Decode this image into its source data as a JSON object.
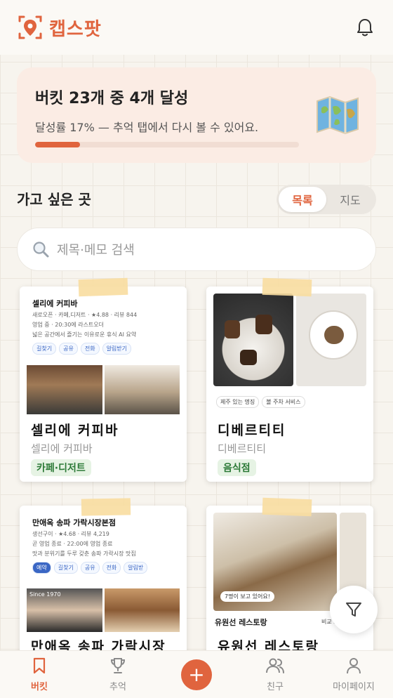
{
  "header": {
    "logo_text": "캡스팟",
    "logo_icon": "map-pin-icon",
    "bell_icon": "bell-icon"
  },
  "progress": {
    "title": "버킷 23개 중 4개 달성",
    "subtitle": "달성률 17% — 추억 탭에서 다시 볼 수 있어요.",
    "fraction": 0.17,
    "icon": "world-map-icon"
  },
  "section": {
    "title": "가고 싶은 곳"
  },
  "view_toggle": {
    "options": [
      "목록",
      "지도"
    ],
    "selected": "목록"
  },
  "search": {
    "placeholder": "제목·메모 검색"
  },
  "cards": [
    {
      "name": "셀리에 커피바",
      "subtitle": "셀리에 커피바",
      "tag": "카페·디저트",
      "thumb": {
        "title": "셀리에 커피바",
        "line1": "새로오픈 · 카페,디저트 · ★4.88 · 리뷰 844",
        "line2": "영업 중 · 20:30에 라스트오더",
        "line3": "넓은 공간에서 즐기는 이유로운 휴식 AI 요약",
        "chips": [
          "길찾기",
          "공유",
          "전화",
          "알림받기"
        ]
      }
    },
    {
      "name": "디베르티티",
      "subtitle": "디베르티티",
      "tag": "음식점",
      "thumb": {
        "chips": [
          "제주 있는 명징",
          "볼 주차 서비스"
        ]
      }
    },
    {
      "name": "만애옥 송파 가락시장",
      "subtitle": "",
      "tag": "",
      "thumb": {
        "title": "만애옥 송파 가락시장본점",
        "line1": "생선구이 · ★4.68 · 리뷰 4,219",
        "line2": "곧 영업 종료 · 22:00에 영업 종료",
        "line3": "맛과 분위기를 두루 갖춘 송파 가락시장 맛집",
        "chips": [
          "예약",
          "길찾기",
          "공유",
          "전화",
          "알림받"
        ],
        "photo_caption": "Since 1970"
      }
    },
    {
      "name": "유원선 레스토랑",
      "subtitle": "",
      "tag": "",
      "thumb": {
        "caption": "유원선 레스토랑",
        "badge": "7명이 보고 있어요!",
        "side": "비교 보"
      }
    }
  ],
  "filter_button": {
    "icon": "filter-icon"
  },
  "tabbar": {
    "items": [
      {
        "label": "버킷",
        "icon": "bookmark-icon",
        "active": true
      },
      {
        "label": "추억",
        "icon": "trophy-icon",
        "active": false
      },
      {
        "label": "+",
        "icon": "plus-icon",
        "active": false
      },
      {
        "label": "친구",
        "icon": "friends-icon",
        "active": false
      },
      {
        "label": "마이페이지",
        "icon": "user-icon",
        "active": false
      }
    ]
  },
  "colors": {
    "accent": "#e0643e",
    "tag_bg": "#e6f3e4",
    "tag_text": "#2c7a37"
  }
}
